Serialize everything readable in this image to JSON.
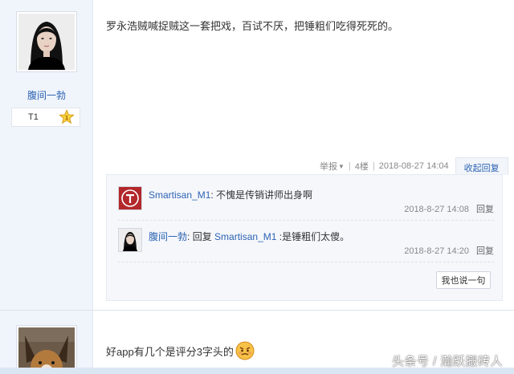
{
  "post1": {
    "username": "腹间一勃",
    "level": "T1",
    "content": "罗永浩贼喊捉贼这一套把戏，百试不厌，把锤粗们吃得死死的。",
    "meta": {
      "report": "举报",
      "floor": "4楼",
      "time": "2018-08-27 14:04",
      "collapse": "收起回复"
    },
    "replies": [
      {
        "user": "Smartisan_M1",
        "text": "不愧是传销讲师出身啊",
        "time": "2018-8-27 14:08",
        "reply_label": "回复"
      },
      {
        "user": "腹间一勃",
        "prefix": "回复",
        "target": "Smartisan_M1",
        "text": ":是锤粗们太傻。",
        "time": "2018-8-27 14:20",
        "reply_label": "回复"
      }
    ],
    "say_button": "我也说一句"
  },
  "post2": {
    "content": "好app有几个是评分3字头的"
  },
  "watermark": "头条号 / 瀚跃搬砖人",
  "colors": {
    "link": "#2d64b3",
    "sidebar_bg": "#f0f4fb",
    "reply_bg": "#f5f7fb"
  }
}
